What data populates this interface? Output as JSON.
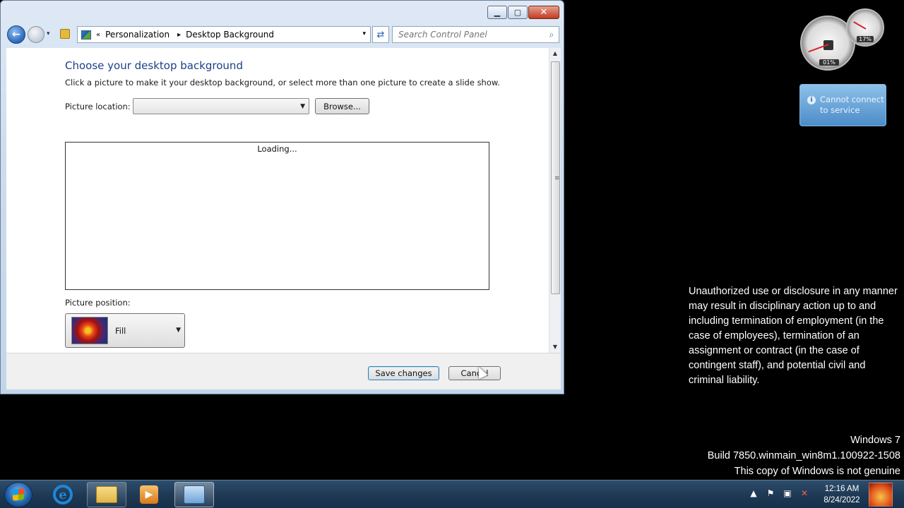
{
  "window": {
    "caption": {
      "minimize": "▁",
      "maximize": "▢",
      "close": "✕"
    },
    "nav": {
      "back": "←",
      "recent": "▾",
      "breadcrumb_more": "«",
      "crumb_sep": "▸",
      "crumb1": "Personalization",
      "crumb2": "Desktop Background",
      "addr_drop": "▾",
      "refresh": "⇄"
    },
    "search": {
      "placeholder": "Search Control Panel",
      "icon": "⌕"
    },
    "content": {
      "title": "Choose your desktop background",
      "instruction": "Click a picture to make it your desktop background, or select more than one picture to create a slide show.",
      "picture_location_label": "Picture location:",
      "picture_location_value": "",
      "browse_label": "Browse...",
      "gallery_loading": "Loading...",
      "picture_position_label": "Picture position:",
      "picture_position_value": "Fill"
    },
    "footer": {
      "save_label": "Save changes",
      "cancel_label": "Cancel"
    }
  },
  "gadgets": {
    "cpu_meter": {
      "cpu_percent": "01%",
      "memory_percent": "17%"
    },
    "weather": {
      "message": "Cannot connect to service",
      "info_icon": "i"
    }
  },
  "desktop": {
    "disclaimer": "Unauthorized use or disclosure in any manner may result in disciplinary action up to and including termination of employment (in the case of employees), termination of an assignment or contract (in the case of contingent staff), and potential civil and criminal liability.",
    "watermark_line1": "Windows 7",
    "watermark_line2": "Build 7850.winmain_win8m1.100922-1508",
    "watermark_line3": "This copy of Windows is not genuine"
  },
  "taskbar": {
    "ie_glyph": "e",
    "media_glyph": "▶",
    "tray_icons": {
      "show_hidden": "▲",
      "action_center": "⚑",
      "network": "▣",
      "volume": "✕"
    },
    "clock_time": "12:16 AM",
    "clock_date": "8/24/2022"
  }
}
